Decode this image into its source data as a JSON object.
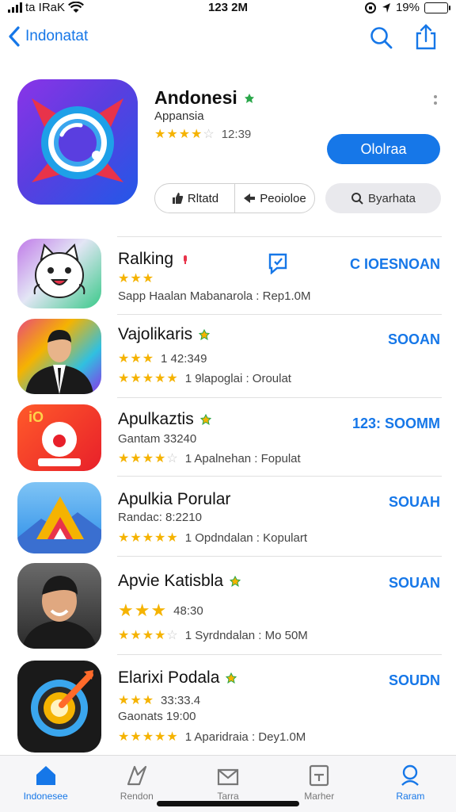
{
  "status_bar": {
    "carrier": "ta IRaK",
    "time": "123 2M",
    "battery": "19%",
    "battery_level": 0.19
  },
  "nav": {
    "back_label": "Indonatat"
  },
  "hero": {
    "title": "Andonesi",
    "subtitle": "Appansia",
    "rating_text": "12:39",
    "stars": 4,
    "get_label": "Ololraa",
    "seg_left": "Rltatd",
    "seg_right": "Peoioloe",
    "search_label": "Byarhata"
  },
  "rows": [
    {
      "title": "Ralking",
      "line1_stars": 3,
      "line1_text": "",
      "line2": "Sapp Haalan Mabanarola : Rep1.0M",
      "line2_stars": 0,
      "action": "C IOESNOAN",
      "badge": "pin-red"
    },
    {
      "title": "Vajolikaris",
      "line1_stars": 3,
      "line1_text": "1 42:349",
      "line2": "1 9lapoglai : Oroulat",
      "line2_stars": 5,
      "action": "SOOAN",
      "badge": "star-green"
    },
    {
      "title": "Apulkaztis",
      "line1_text": "Gantam 33240",
      "line1_stars": 0,
      "line2": "1 Apalnehan : Fopulat",
      "line2_stars": 4,
      "action": "123: SOOMM",
      "badge": "star-green"
    },
    {
      "title": "Apulkia Porular",
      "line1_text": "Randac: 8:2210",
      "line1_stars": 0,
      "line2": "1 Opdndalan : Kopulart",
      "line2_stars": 5,
      "action": "SOUAH",
      "badge": ""
    },
    {
      "title": "Apvie Katisbla",
      "line1_stars": 3,
      "line1_text": "48:30",
      "line2": "1 Syrdndalan : Mo 50M",
      "line2_stars": 4,
      "action": "SOUAN",
      "badge": "star-green"
    },
    {
      "title": "Elarixi Podala",
      "line1_stars": 3,
      "line1_text": "33:33.4",
      "line1b": "Gaonats 19:00",
      "line2": "1 Aparidraia : Dey1.0M",
      "line2_stars": 5,
      "action": "SOUDN",
      "badge": "star-green"
    }
  ],
  "tabs": [
    {
      "label": "Indonesee",
      "icon": "home-icon",
      "active": true
    },
    {
      "label": "Rendon",
      "icon": "games-icon",
      "active": false
    },
    {
      "label": "Tarra",
      "icon": "apps-icon",
      "active": false
    },
    {
      "label": "Marher",
      "icon": "arcade-icon",
      "active": false
    },
    {
      "label": "Raram",
      "icon": "search-icon",
      "active": false
    }
  ],
  "colors": {
    "accent": "#1677e8",
    "star": "#f5b301"
  }
}
